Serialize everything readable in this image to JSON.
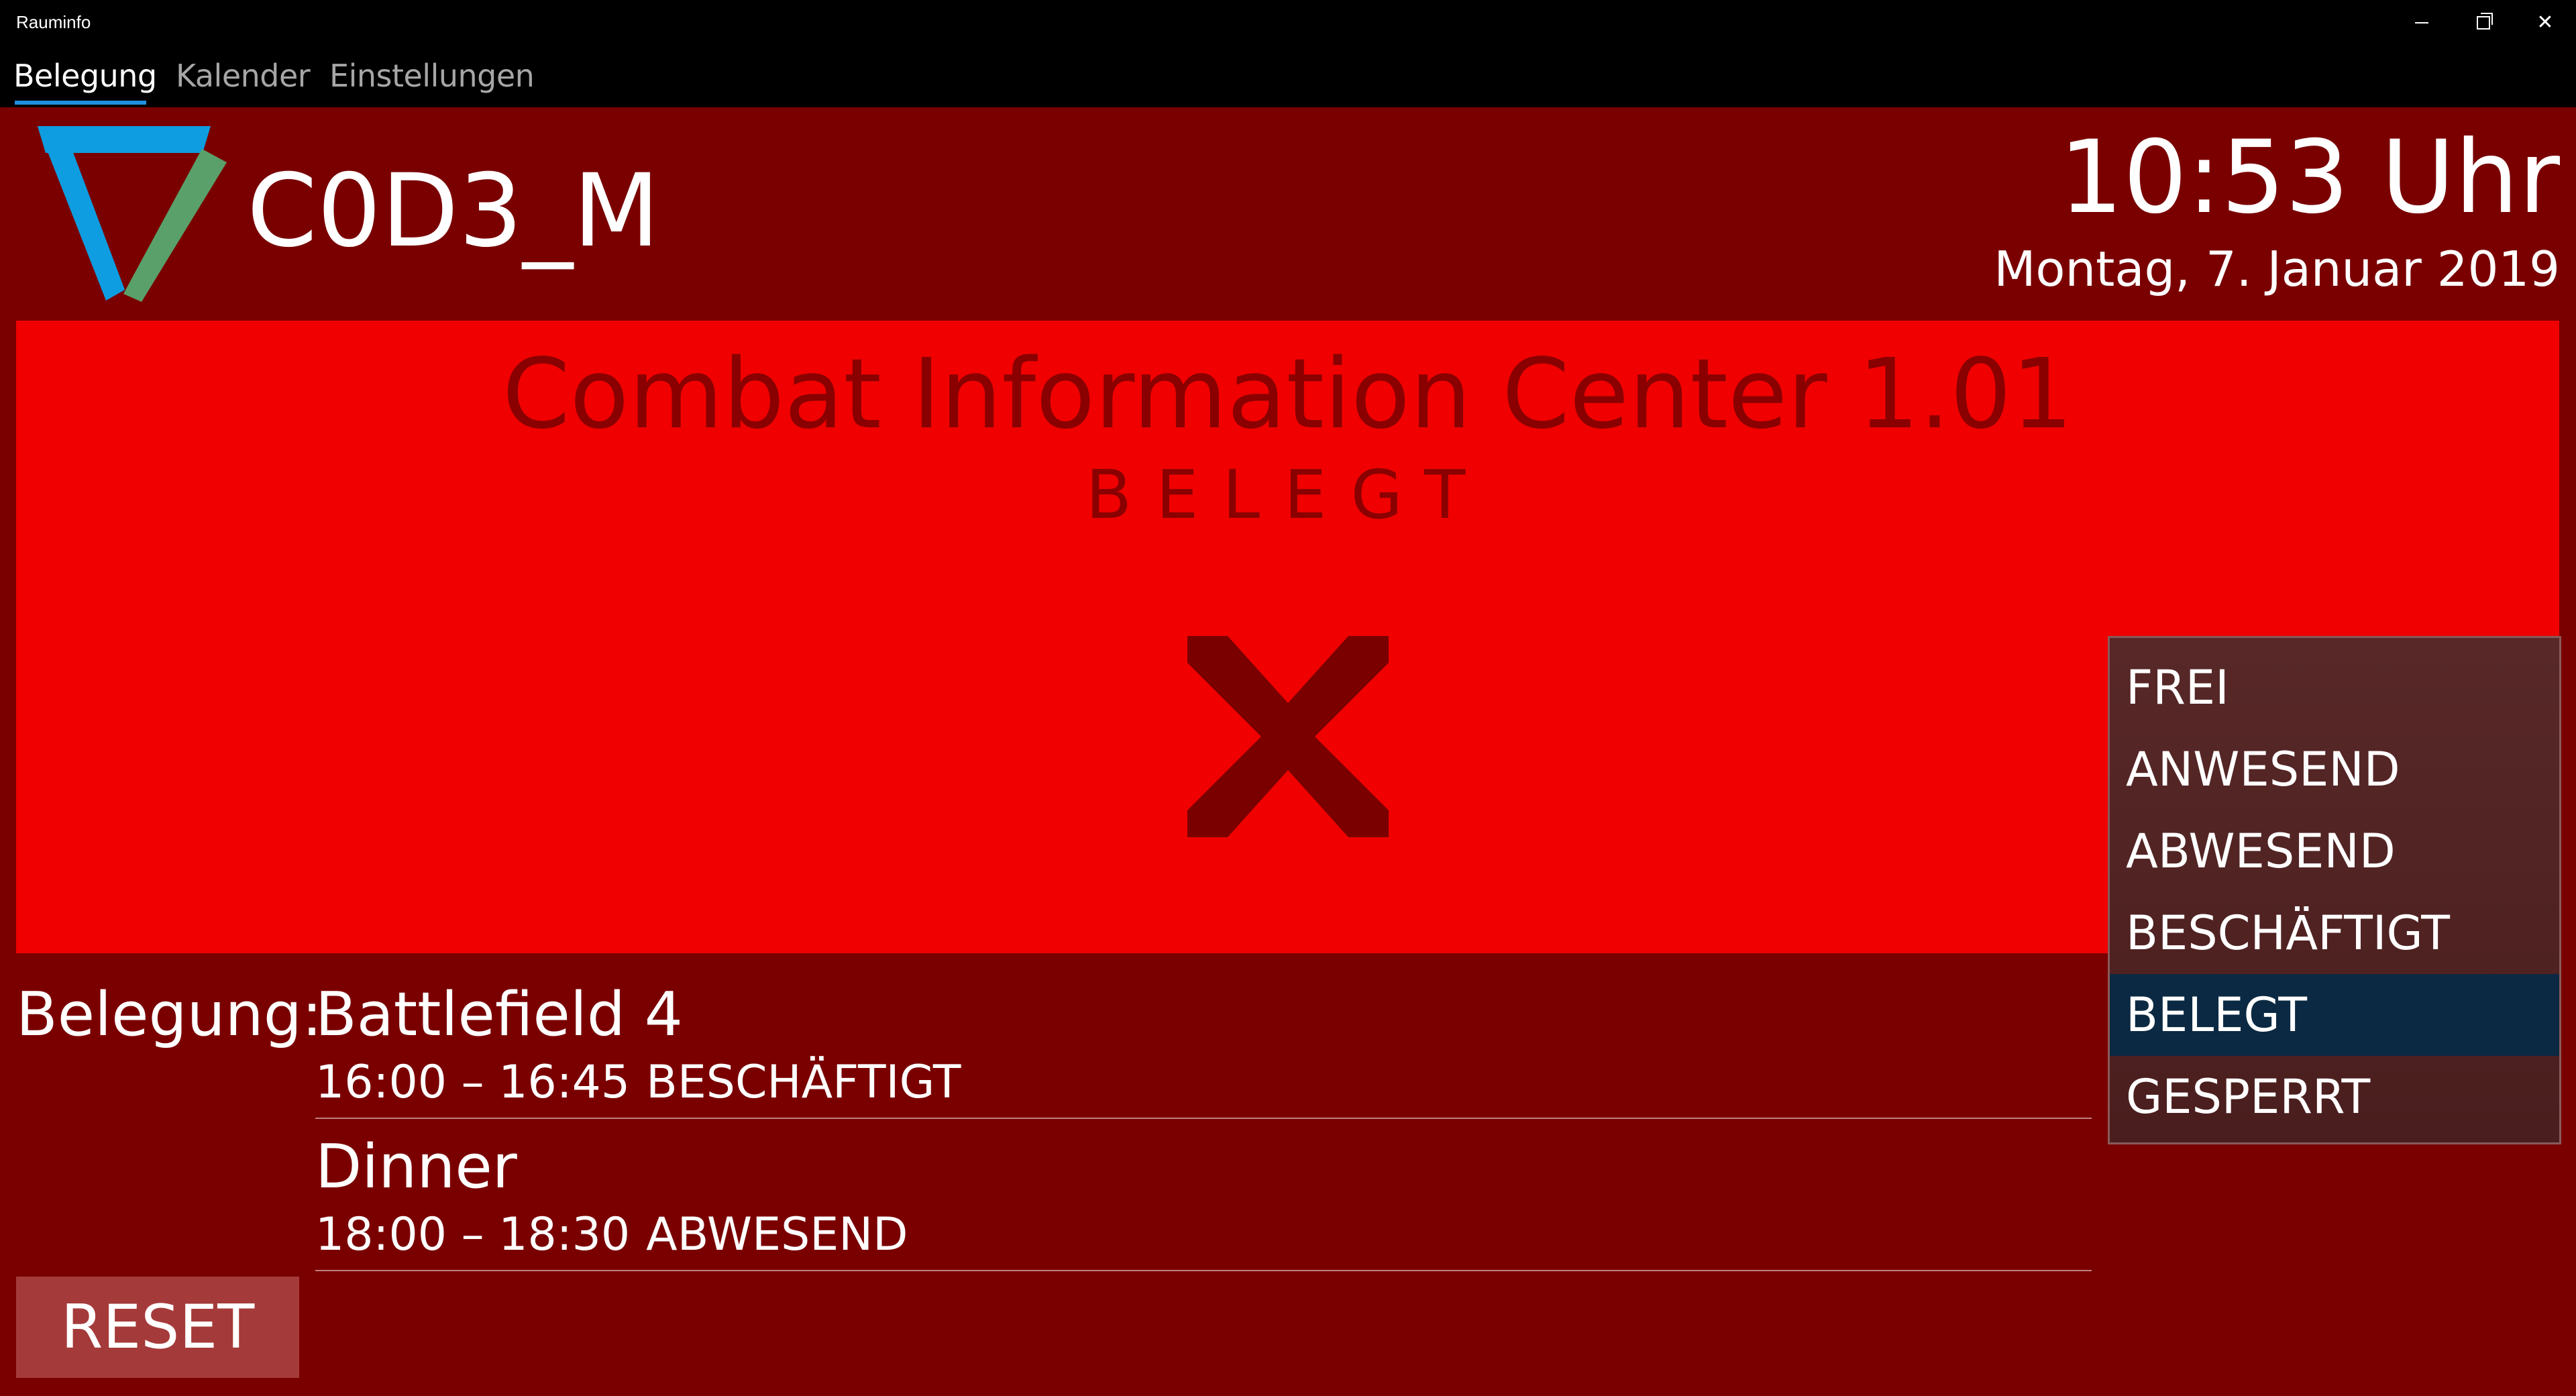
{
  "window": {
    "title": "Rauminfo",
    "close_glyph": "✕"
  },
  "nav": {
    "tabs": [
      {
        "label": "Belegung",
        "active": true
      },
      {
        "label": "Kalender",
        "active": false
      },
      {
        "label": "Einstellungen",
        "active": false
      }
    ]
  },
  "header": {
    "brand_name": "C0D3_M",
    "logo_icon": "triangle-logo-icon",
    "time": "10:53 Uhr",
    "date": "Montag, 7. Januar 2019"
  },
  "status": {
    "room_name": "Combat Information Center  1.01",
    "label": "BELEGT",
    "icon": "x-mark-icon",
    "panel_color": "#f00000",
    "text_color": "#8a0000"
  },
  "bookings": {
    "prefix": "Belegung:",
    "items": [
      {
        "title": "Battlefield 4",
        "time": "16:00 – 16:45",
        "state": "BESCHÄFTIGT"
      },
      {
        "title": "Dinner",
        "time": "18:00 – 18:30",
        "state": "ABWESEND"
      }
    ]
  },
  "reset_button": {
    "label": "RESET"
  },
  "status_menu": {
    "options": [
      "FREI",
      "ANWESEND",
      "ABWESEND",
      "BESCHÄFTIGT",
      "BELEGT",
      "GESPERRT"
    ],
    "selected": "BELEGT"
  },
  "colors": {
    "background": "#7a0000",
    "accent": "#1f8fe0",
    "menu_selected": "#0b2942",
    "logo_blue": "#0e9de0",
    "logo_green": "#5aa06a"
  }
}
